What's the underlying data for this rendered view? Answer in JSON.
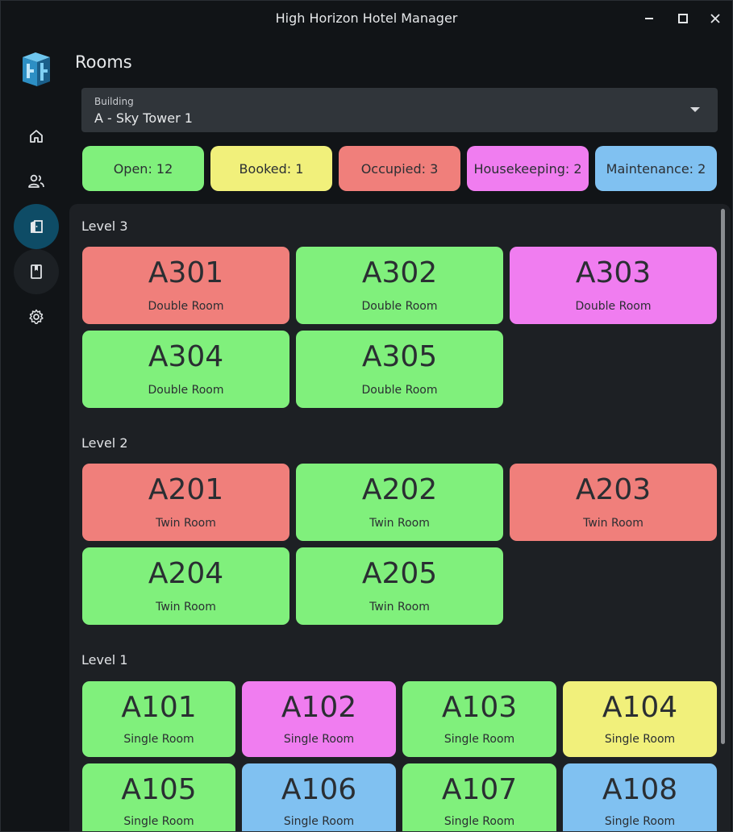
{
  "window": {
    "title": "High Horizon Hotel Manager"
  },
  "colors": {
    "open": "#80f07c",
    "booked": "#f1f07b",
    "occupied": "#f07f7b",
    "housekeeping": "#f07df0",
    "maintenance": "#80c1f1",
    "nav_active": "#0e4c66"
  },
  "sidebar": {
    "items": [
      {
        "icon": "home-icon",
        "active": false
      },
      {
        "icon": "guests-icon",
        "active": false
      },
      {
        "icon": "rooms-door-icon",
        "active": true
      },
      {
        "icon": "bookings-book-icon",
        "active": false
      },
      {
        "icon": "settings-gear-icon",
        "active": false
      }
    ]
  },
  "page": {
    "title": "Rooms"
  },
  "building": {
    "label": "Building",
    "value": "A - Sky Tower 1"
  },
  "summary": {
    "open": "Open: 12",
    "booked": "Booked: 1",
    "occupied": "Occupied: 3",
    "housekeeping": "Housekeeping: 2",
    "maintenance": "Maintenance: 2"
  },
  "levels": {
    "level3": {
      "label": "Level 3",
      "rooms": [
        {
          "number": "A301",
          "type": "Double Room",
          "status": "occupied"
        },
        {
          "number": "A302",
          "type": "Double Room",
          "status": "open"
        },
        {
          "number": "A303",
          "type": "Double Room",
          "status": "housekeeping"
        },
        {
          "number": "A304",
          "type": "Double Room",
          "status": "open"
        },
        {
          "number": "A305",
          "type": "Double Room",
          "status": "open"
        }
      ]
    },
    "level2": {
      "label": "Level 2",
      "rooms": [
        {
          "number": "A201",
          "type": "Twin Room",
          "status": "occupied"
        },
        {
          "number": "A202",
          "type": "Twin Room",
          "status": "open"
        },
        {
          "number": "A203",
          "type": "Twin Room",
          "status": "occupied"
        },
        {
          "number": "A204",
          "type": "Twin Room",
          "status": "open"
        },
        {
          "number": "A205",
          "type": "Twin Room",
          "status": "open"
        }
      ]
    },
    "level1": {
      "label": "Level 1",
      "rooms": [
        {
          "number": "A101",
          "type": "Single Room",
          "status": "open"
        },
        {
          "number": "A102",
          "type": "Single Room",
          "status": "housekeeping"
        },
        {
          "number": "A103",
          "type": "Single Room",
          "status": "open"
        },
        {
          "number": "A104",
          "type": "Single Room",
          "status": "booked"
        },
        {
          "number": "A105",
          "type": "Single Room",
          "status": "open"
        },
        {
          "number": "A106",
          "type": "Single Room",
          "status": "maintenance"
        },
        {
          "number": "A107",
          "type": "Single Room",
          "status": "open"
        },
        {
          "number": "A108",
          "type": "Single Room",
          "status": "maintenance"
        }
      ]
    }
  }
}
